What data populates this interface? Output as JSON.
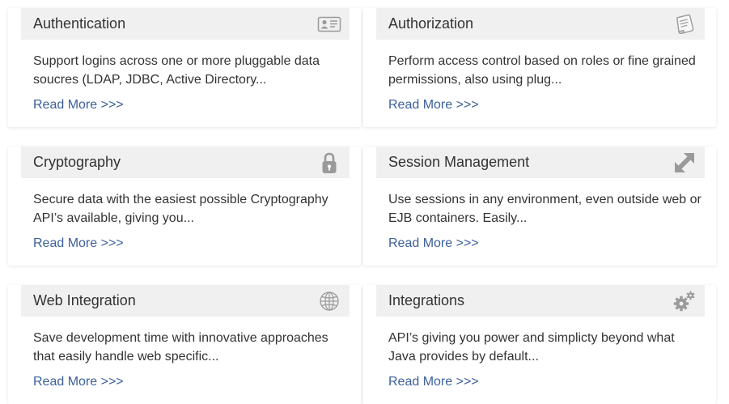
{
  "cards": [
    {
      "title": "Authentication",
      "description": "Support logins across one or more pluggable data soucres (LDAP, JDBC, Active Directory...",
      "link": "Read More >>>",
      "icon": "id-card-icon"
    },
    {
      "title": "Authorization",
      "description": "Perform access control based on roles or fine grained permissions, also using plug...",
      "link": "Read More >>>",
      "icon": "scroll-icon"
    },
    {
      "title": "Cryptography",
      "description": "Secure data with the easiest possible Cryptography API’s available, giving you...",
      "link": "Read More >>>",
      "icon": "padlock-icon"
    },
    {
      "title": "Session Management",
      "description": "Use sessions in any environment, even outside web or EJB containers. Easily...",
      "link": "Read More >>>",
      "icon": "transfer-arrows-icon"
    },
    {
      "title": "Web Integration",
      "description": "Save development time with innovative approaches that easily handle web specific...",
      "link": "Read More >>>",
      "icon": "globe-icon"
    },
    {
      "title": "Integrations",
      "description": "API’s giving you power and simplicty beyond what Java provides by default...",
      "link": "Read More >>>",
      "icon": "gears-icon"
    }
  ],
  "colors": {
    "header_bg": "#f0f0f0",
    "title_text": "#333333",
    "body_text": "#333333",
    "link": "#3c5f9a",
    "icon": "#9a9a9a"
  }
}
